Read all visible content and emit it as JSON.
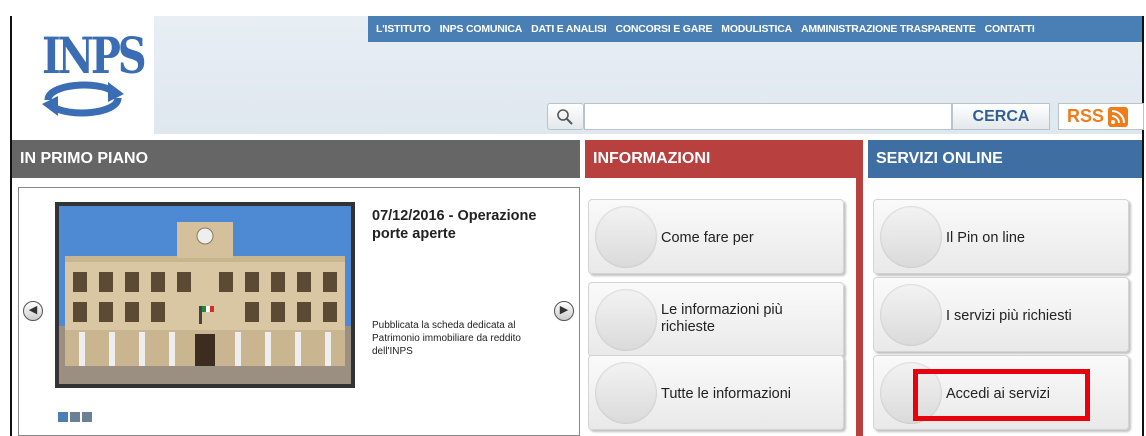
{
  "header": {
    "logo": "INPS",
    "nav": [
      "L'ISTITUTO",
      "INPS COMUNICA",
      "DATI E ANALISI",
      "CONCORSI E GARE",
      "MODULISTICA",
      "AMMINISTRAZIONE TRASPARENTE",
      "CONTATTI"
    ],
    "search": {
      "value": "",
      "placeholder": "",
      "button_label": "CERCA"
    },
    "rss_label": "RSS"
  },
  "sections": {
    "primo_piano": "IN PRIMO PIANO",
    "informazioni": "INFORMAZIONI",
    "servizi": "SERVIZI ONLINE"
  },
  "news": {
    "title": "07/12/2016 - Operazione porte aperte",
    "description": "Pubblicata la scheda dedicata al Patrimonio immobiliare da reddito dell'INPS",
    "slides": 3,
    "active_slide": 0
  },
  "informazioni_tiles": [
    "Come fare per",
    "Le informazioni più richieste",
    "Tutte le informazioni"
  ],
  "servizi_tiles": [
    "Il Pin on line",
    "I servizi più richiesti",
    "Accedi ai servizi"
  ],
  "colors": {
    "nav_blue": "#4a7fb5",
    "info_red": "#b8403e",
    "servizi_blue": "#3f6ea2",
    "primo_gray": "#666666",
    "highlight_red": "#e8000b",
    "dot_active": "#4a7fb5",
    "dot_inactive": "#6b7f95"
  }
}
